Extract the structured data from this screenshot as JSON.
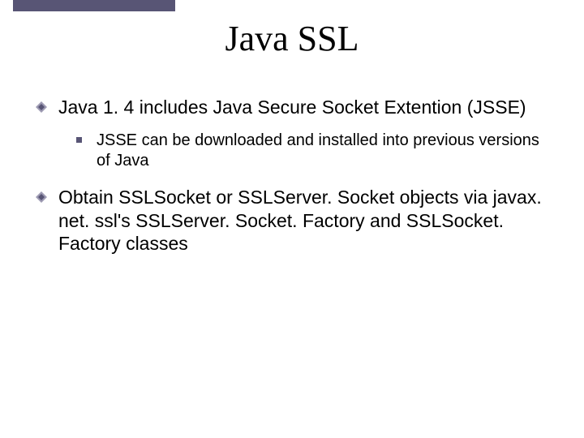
{
  "title": "Java SSL",
  "bullets": {
    "b1": "Java 1. 4 includes Java Secure Socket Extention (JSSE)",
    "b1_sub": "JSSE can be downloaded and installed into previous versions of Java",
    "b2": "Obtain SSLSocket or SSLServer. Socket objects via javax. net. ssl's SSLServer. Socket. Factory and SSLSocket. Factory classes"
  },
  "colors": {
    "accent": "#585575",
    "bullet_outer": "#9e9bb3",
    "bullet_inner": "#585575"
  }
}
